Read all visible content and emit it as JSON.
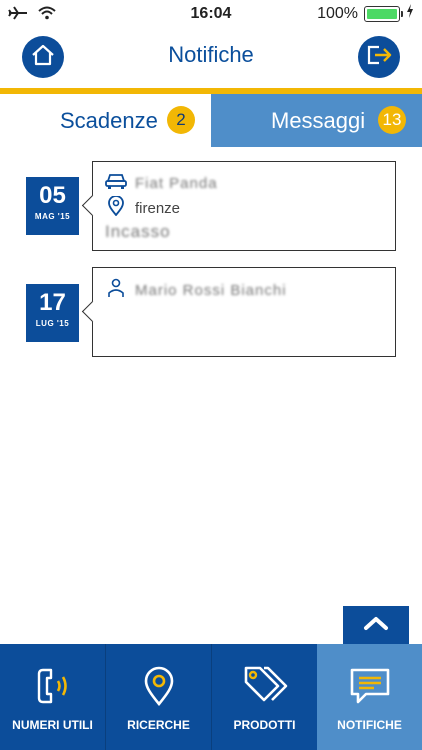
{
  "status_bar": {
    "time": "16:04",
    "battery": "100%"
  },
  "header": {
    "title": "Notifiche"
  },
  "tabs": [
    {
      "label": "Scadenze",
      "count": "2"
    },
    {
      "label": "Messaggi",
      "count": "13"
    }
  ],
  "notifications": [
    {
      "day": "05",
      "month": "MAG '15",
      "line1": "Fiat Panda",
      "line2": "firenze",
      "line3": "Incasso"
    },
    {
      "day": "17",
      "month": "LUG '15",
      "line1": "Mario Rossi Bianchi"
    }
  ],
  "nav": [
    {
      "label": "NUMERI UTILI"
    },
    {
      "label": "RICERCHE"
    },
    {
      "label": "PRODOTTI"
    },
    {
      "label": "NOTIFICHE"
    }
  ],
  "colors": {
    "primary": "#0c4d9a",
    "accent": "#f2b705",
    "active_tab": "#4f8ec9"
  }
}
